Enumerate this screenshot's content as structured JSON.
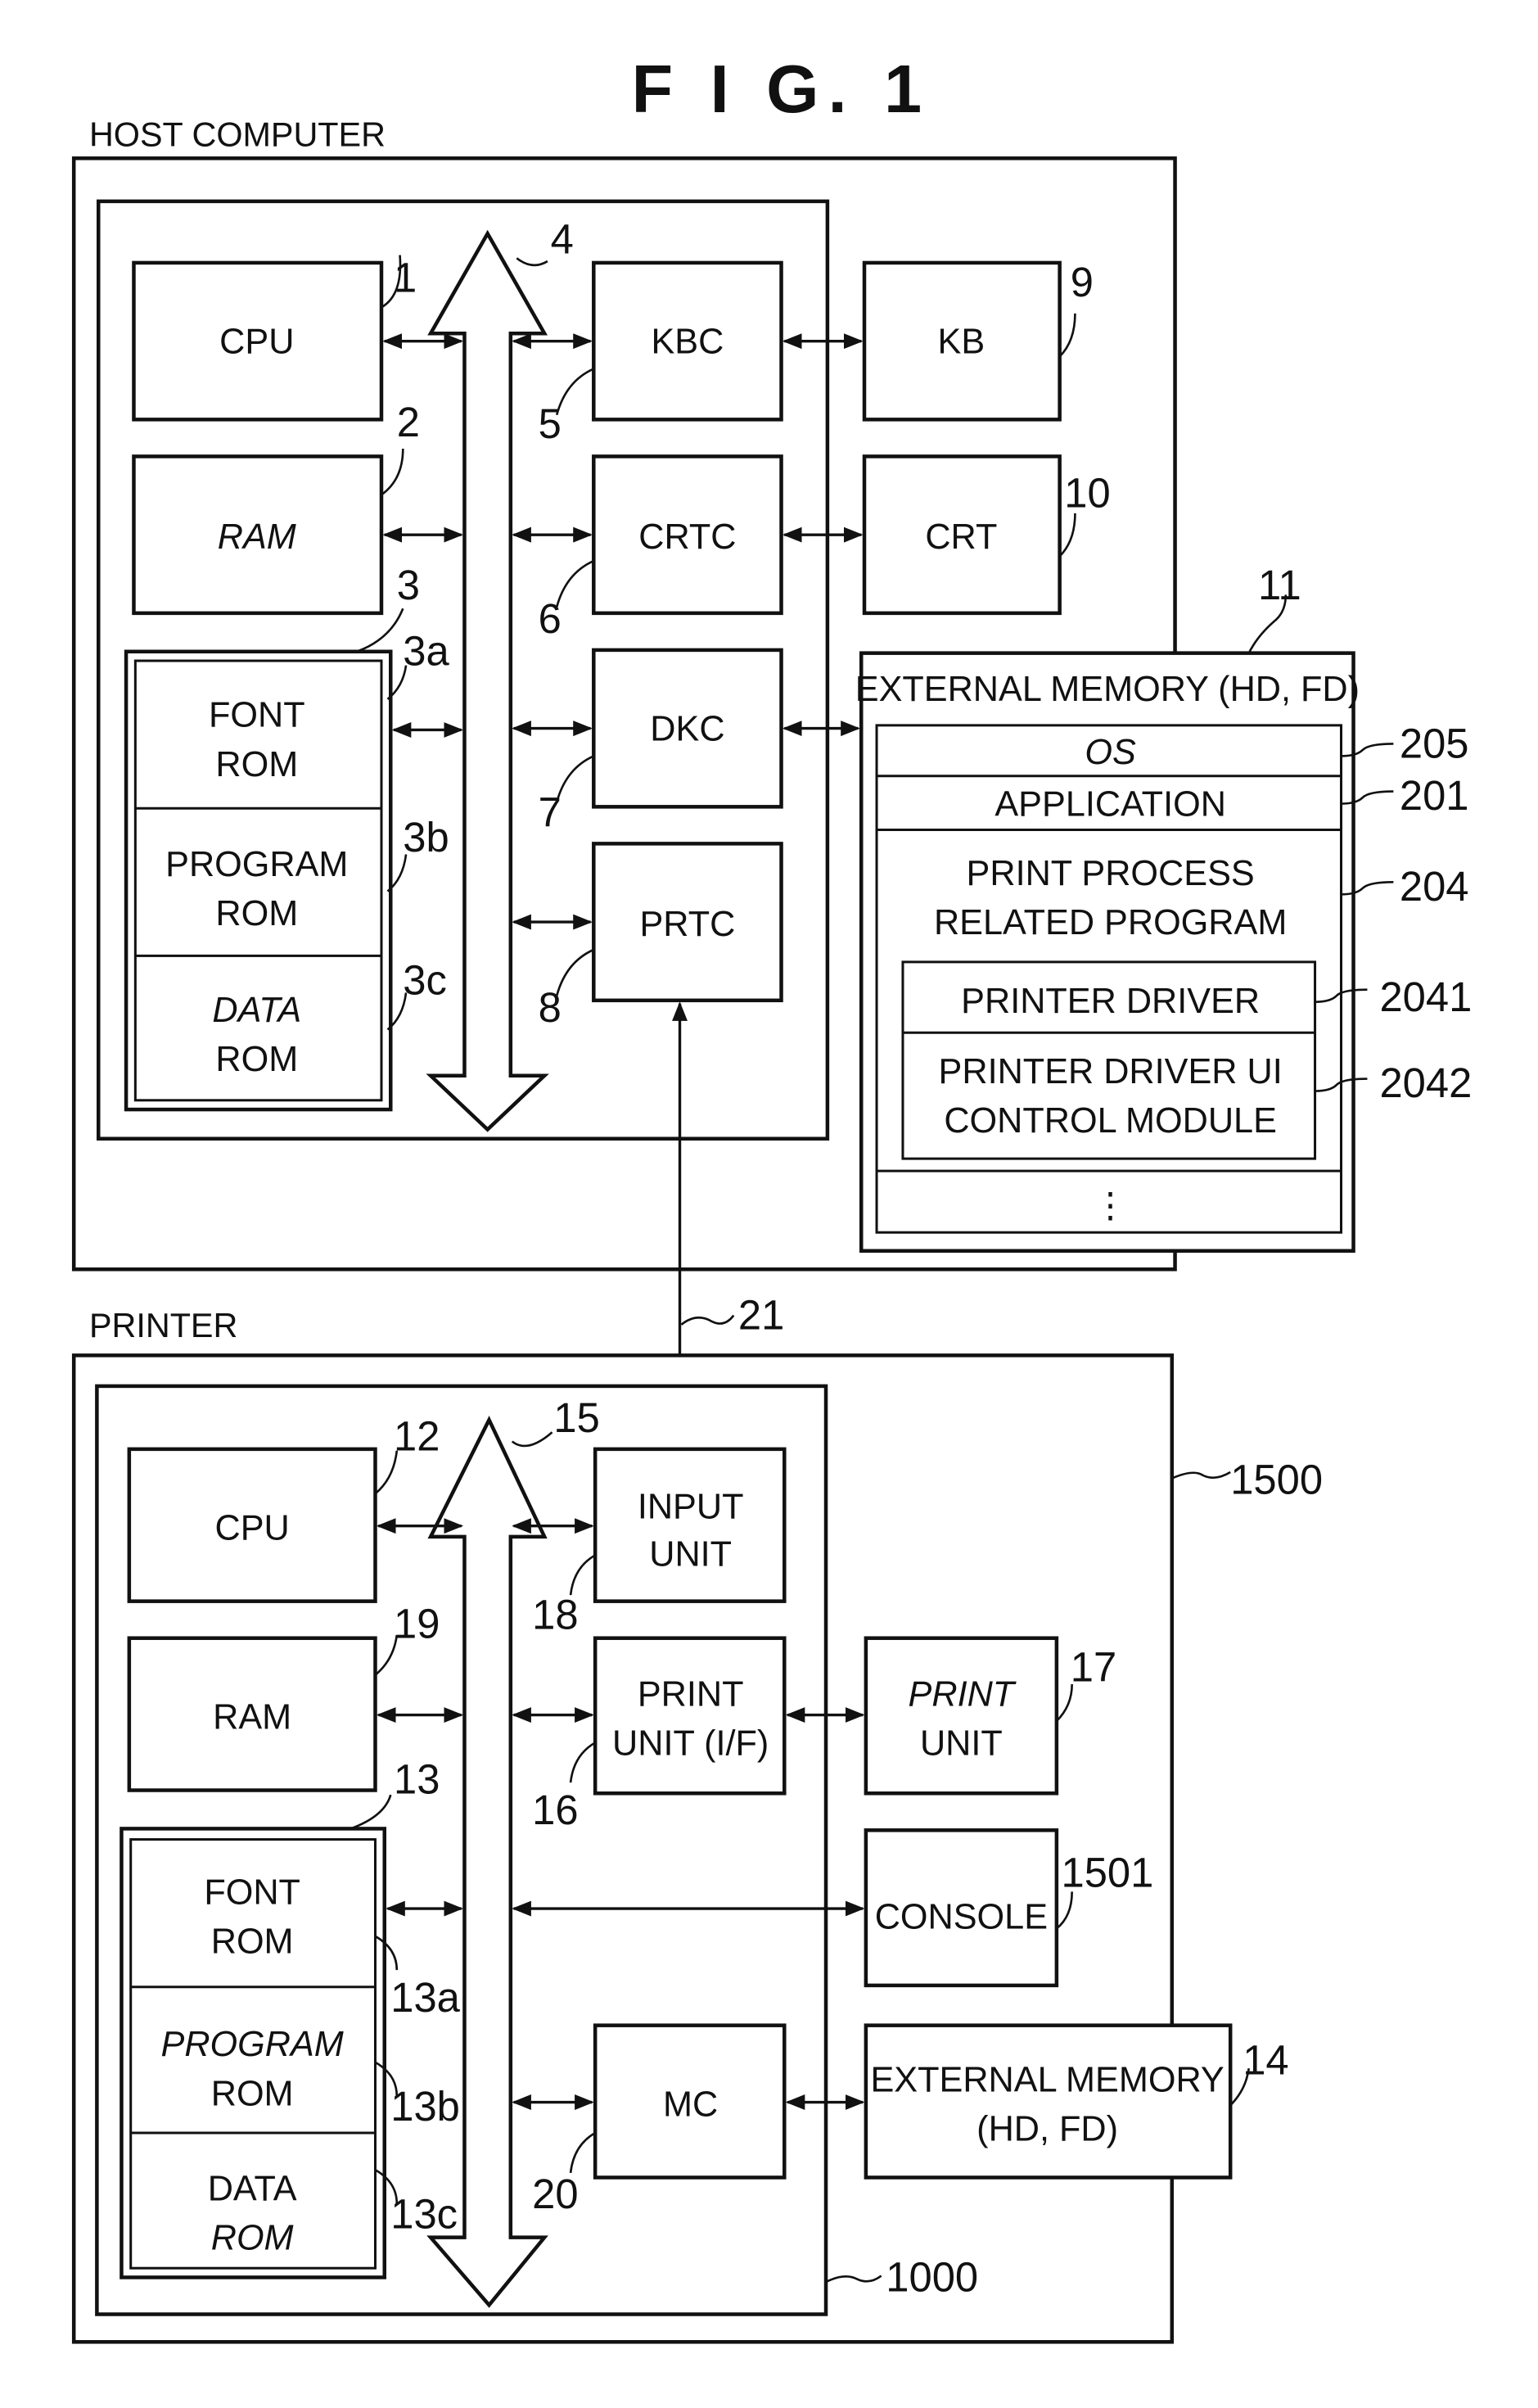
{
  "figure": {
    "title": "F I G. 1"
  },
  "host": {
    "section_label": "HOST COMPUTER",
    "cpu": {
      "label": "CPU",
      "ref": "1"
    },
    "ram": {
      "label": "RAM",
      "ref": "2"
    },
    "rom": {
      "ref": "3",
      "font": {
        "line1": "FONT",
        "line2": "ROM",
        "ref": "3a"
      },
      "program": {
        "line1": "PROGRAM",
        "line2": "ROM",
        "ref": "3b"
      },
      "data": {
        "line1": "DATA",
        "line2": "ROM",
        "ref": "3c"
      }
    },
    "bus_ref": "4",
    "kbc": {
      "label": "KBC",
      "ref": "5"
    },
    "crtc": {
      "label": "CRTC",
      "ref": "6"
    },
    "dkc": {
      "label": "DKC",
      "ref": "7"
    },
    "prtc": {
      "label": "PRTC",
      "ref": "8"
    },
    "kb": {
      "label": "KB",
      "ref": "9"
    },
    "crt": {
      "label": "CRT",
      "ref": "10"
    },
    "external_memory": {
      "ref": "11",
      "title": "EXTERNAL MEMORY (HD, FD)",
      "os": {
        "label": "OS",
        "ref": "205"
      },
      "application": {
        "label": "APPLICATION",
        "ref": "201"
      },
      "print_process": {
        "line1": "PRINT PROCESS",
        "line2": "RELATED PROGRAM",
        "ref": "204"
      },
      "printer_driver": {
        "label": "PRINTER DRIVER",
        "ref": "2041"
      },
      "ui_module": {
        "line1": "PRINTER DRIVER UI",
        "line2": "CONTROL MODULE",
        "ref": "2042"
      },
      "ellipsis": "⋮"
    }
  },
  "link_ref": "21",
  "printer": {
    "section_label": "PRINTER",
    "outer_ref": "1500",
    "controller_ref": "1000",
    "cpu": {
      "label": "CPU",
      "ref": "12"
    },
    "ram": {
      "label": "RAM",
      "ref": "19"
    },
    "rom": {
      "ref": "13",
      "font": {
        "line1": "FONT",
        "line2": "ROM",
        "ref": "13a"
      },
      "program": {
        "line1": "PROGRAM",
        "line2": "ROM",
        "ref": "13b"
      },
      "data": {
        "line1": "DATA",
        "line2": "ROM",
        "ref": "13c"
      }
    },
    "bus_ref": "15",
    "input_unit": {
      "line1": "INPUT",
      "line2": "UNIT",
      "ref": "18"
    },
    "print_if": {
      "line1": "PRINT",
      "line2": "UNIT (I/F)",
      "ref": "16"
    },
    "print_unit": {
      "line1": "PRINT",
      "line2": "UNIT",
      "ref": "17"
    },
    "console": {
      "label": "CONSOLE",
      "ref": "1501"
    },
    "mc": {
      "label": "MC",
      "ref": "20"
    },
    "external_memory": {
      "line1": "EXTERNAL MEMORY",
      "line2": "(HD, FD)",
      "ref": "14"
    }
  }
}
